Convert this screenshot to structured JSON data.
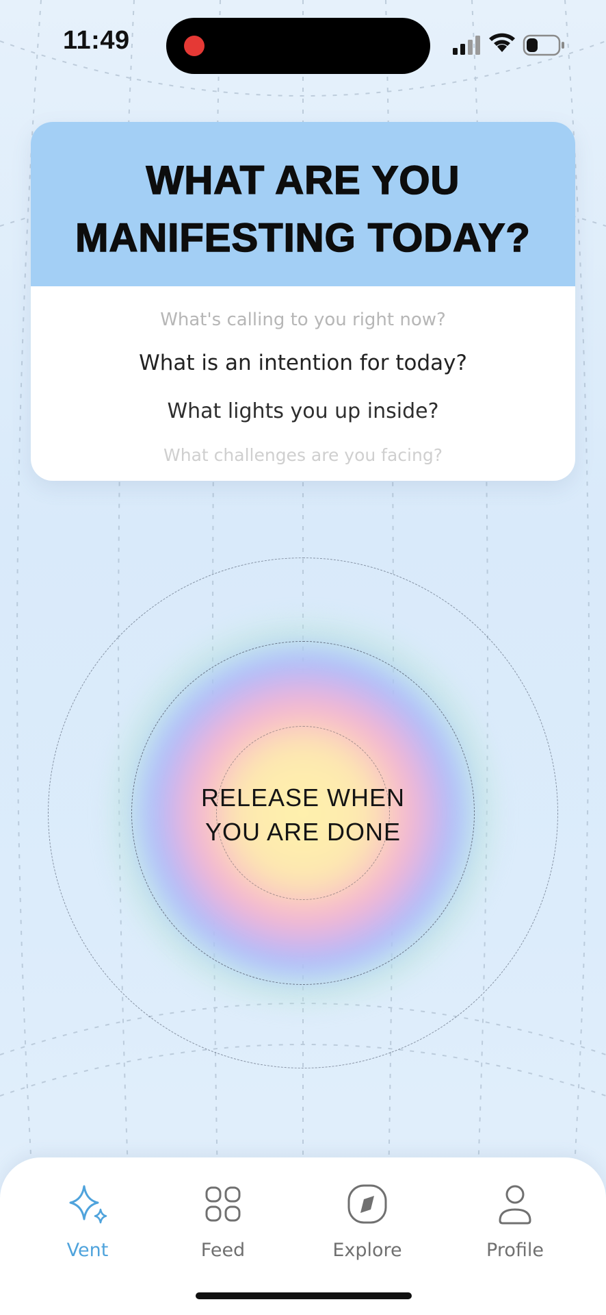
{
  "status_bar": {
    "time": "11:49",
    "icons": [
      "signal-icon",
      "wifi-icon",
      "battery-icon"
    ],
    "recording_indicator_color": "#e53935",
    "battery_level": 0.3
  },
  "card": {
    "title_line1": "WHAT ARE YOU",
    "title_line2": "MANIFESTING TODAY?",
    "header_color": "#a3cff5",
    "prompts": [
      "What's calling to you right now?",
      "What is an intention for today?",
      "What lights you up inside?",
      "What challenges are you facing?"
    ]
  },
  "release": {
    "line1": "RELEASE WHEN",
    "line2": "YOU ARE DONE"
  },
  "tabbar": {
    "active_color": "#4fa3dc",
    "tabs": [
      {
        "label": "Vent",
        "icon": "sparkle-icon",
        "active": true
      },
      {
        "label": "Feed",
        "icon": "grid-icon",
        "active": false
      },
      {
        "label": "Explore",
        "icon": "compass-icon",
        "active": false
      },
      {
        "label": "Profile",
        "icon": "person-icon",
        "active": false
      }
    ]
  }
}
